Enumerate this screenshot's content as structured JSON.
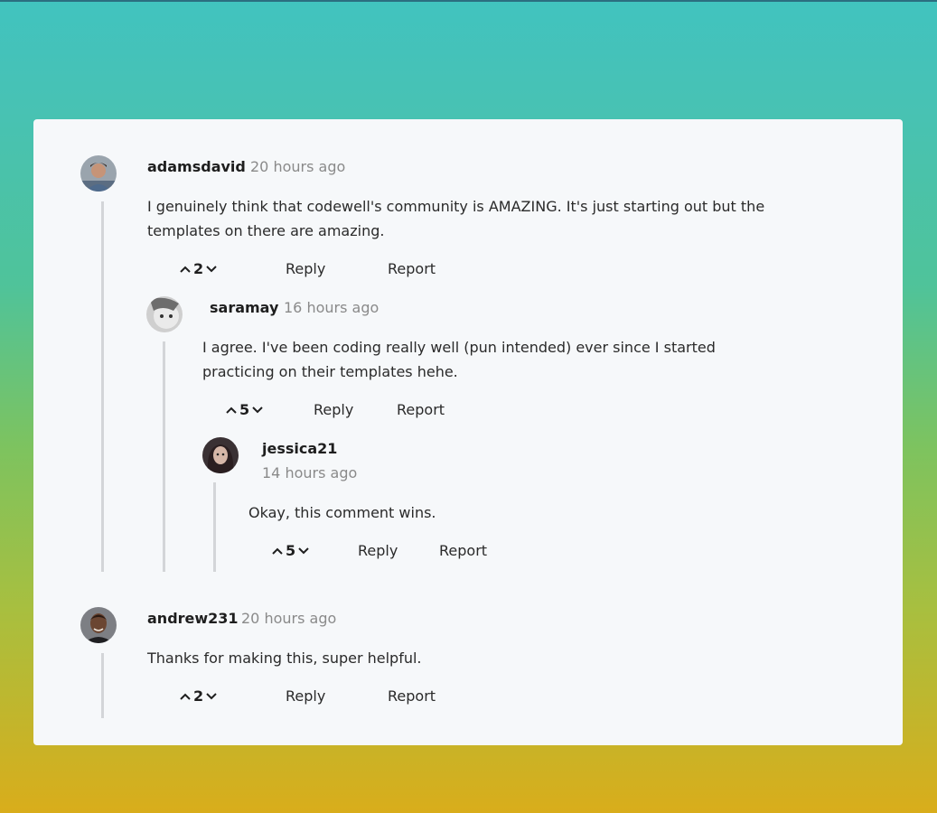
{
  "comments": [
    {
      "user": "adamsdavid",
      "time": "20 hours ago",
      "text": "I genuinely think that codewell's community is AMAZING. It's just starting out but the templates on there are amazing.",
      "votes": "2",
      "reply": "Reply",
      "report": "Report"
    },
    {
      "user": "saramay",
      "time": "16 hours ago",
      "text": "I agree. I've been coding really well (pun intended) ever since I started practicing on their templates hehe.",
      "votes": "5",
      "reply": "Reply",
      "report": "Report"
    },
    {
      "user": "jessica21",
      "time": "14 hours ago",
      "text": "Okay, this comment wins.",
      "votes": "5",
      "reply": "Reply",
      "report": "Report"
    },
    {
      "user": "andrew231",
      "time": "20 hours ago",
      "text": "Thanks for making this, super helpful.",
      "votes": "2",
      "reply": "Reply",
      "report": "Report"
    }
  ],
  "colors": {
    "card": "#f6f8fa",
    "thread_line": "#d3d5d8",
    "muted": "#8a8a8a"
  },
  "icons": {
    "upvote": "chevron-up-icon",
    "downvote": "chevron-down-icon"
  }
}
